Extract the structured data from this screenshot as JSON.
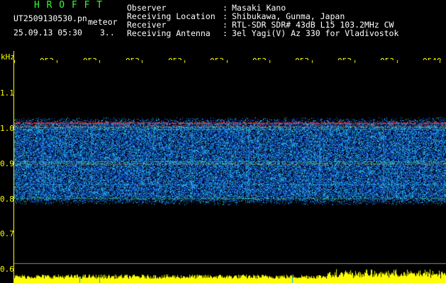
{
  "header": {
    "logo": "H R O F F T",
    "filename": "UT2509130530.pn",
    "meteor_label": "meteor",
    "timestamp": "25.09.13 05:30",
    "count": "3..",
    "info": [
      {
        "key": "Observer",
        "sep": ":",
        "value": "Masaki Kano"
      },
      {
        "key": "Receiving Location",
        "sep": ":",
        "value": "Shibukawa, Gunma, Japan"
      },
      {
        "key": "Receiver",
        "sep": ":",
        "value": "RTL-SDR SDR# 43dB L15 103.2MHz CW"
      },
      {
        "key": "Receiving Antenna",
        "sep": ":",
        "value": "3el Yagi(V) Az 330 for Vladivostok"
      }
    ]
  },
  "axis": {
    "unit": "kHz",
    "y_labels": [
      "1.1",
      "1.0",
      "0.9",
      "0.8",
      "0.7",
      "0.6"
    ],
    "time_labels": [
      "053",
      "053",
      "053",
      "053",
      "053",
      "053",
      "053",
      "053",
      "053",
      "0540"
    ]
  },
  "colors": {
    "background": "#000000",
    "accent_yellow": "#ffff00",
    "logo_green": "#33ff33",
    "signal_red": "#ff2020",
    "noise_blue": "#1a50d0"
  }
}
